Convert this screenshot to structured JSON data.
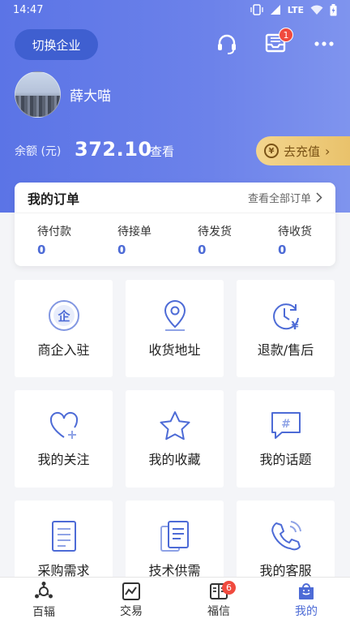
{
  "status": {
    "time": "14:47",
    "network": "LTE"
  },
  "header": {
    "switch_label": "切换企业",
    "message_badge": "1",
    "username": "薛大喵",
    "balance_label": "余额 (元)",
    "balance_value": "372.10",
    "balance_view": "查看",
    "recharge_label": "去充值"
  },
  "orders": {
    "title": "我的订单",
    "view_all": "查看全部订单",
    "stats": [
      {
        "label": "待付款",
        "count": "0"
      },
      {
        "label": "待接单",
        "count": "0"
      },
      {
        "label": "待发货",
        "count": "0"
      },
      {
        "label": "待收货",
        "count": "0"
      }
    ]
  },
  "grid": [
    {
      "label": "商企入驻",
      "icon": "enterprise-icon"
    },
    {
      "label": "收货地址",
      "icon": "location-icon"
    },
    {
      "label": "退款/售后",
      "icon": "refund-icon"
    },
    {
      "label": "我的关注",
      "icon": "heart-icon"
    },
    {
      "label": "我的收藏",
      "icon": "star-icon"
    },
    {
      "label": "我的话题",
      "icon": "topic-icon"
    },
    {
      "label": "采购需求",
      "icon": "document-icon"
    },
    {
      "label": "技术供需",
      "icon": "documents-icon"
    },
    {
      "label": "我的客服",
      "icon": "phone-icon"
    }
  ],
  "nav": [
    {
      "label": "百辐",
      "icon": "home-icon"
    },
    {
      "label": "交易",
      "icon": "trade-icon"
    },
    {
      "label": "福信",
      "icon": "message-icon",
      "badge": "6"
    },
    {
      "label": "我的",
      "icon": "profile-icon"
    }
  ],
  "colors": {
    "accent": "#4d6bd6",
    "hero": "#6c82ea",
    "gold": "#e9c26b",
    "badge": "#f04a3e"
  }
}
